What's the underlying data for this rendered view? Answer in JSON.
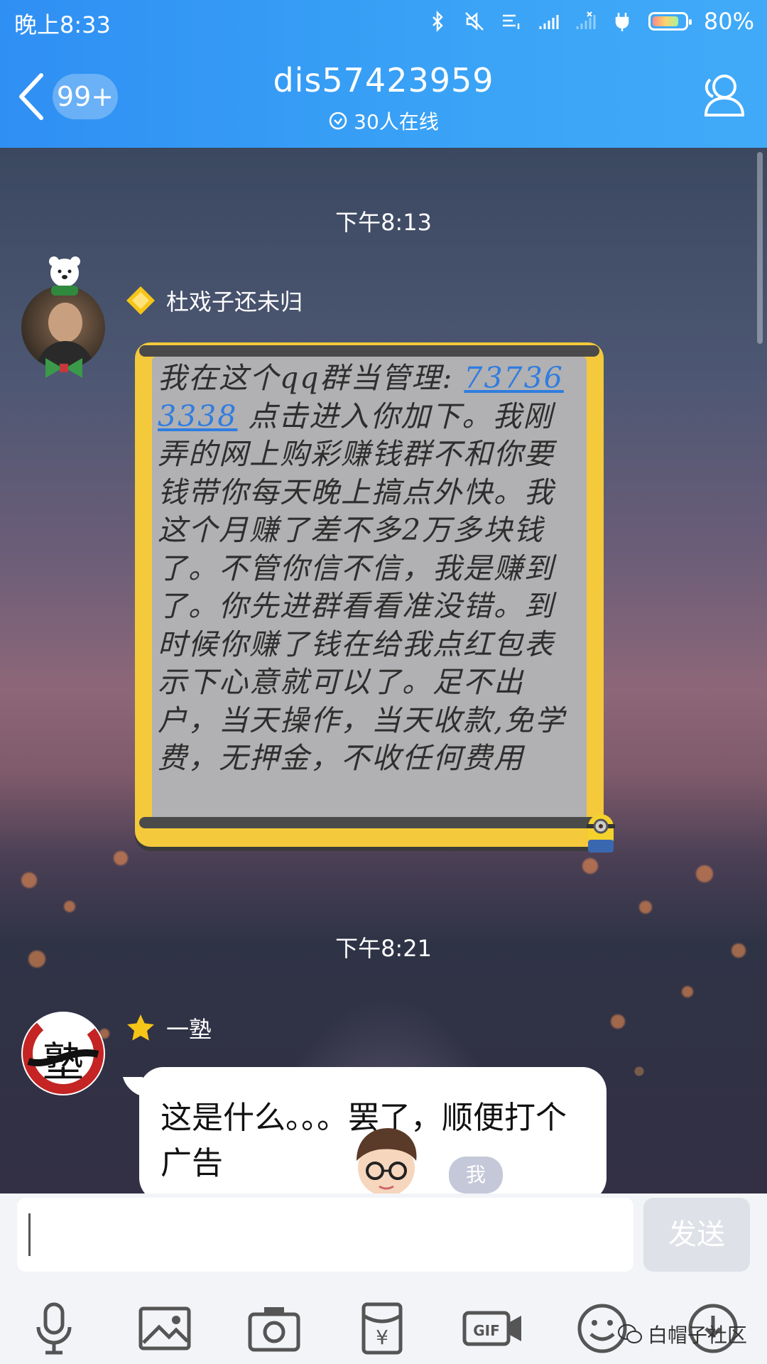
{
  "status_bar": {
    "time": "晚上8:33",
    "battery": "80%"
  },
  "header": {
    "unread_badge": "99+",
    "title": "dis57423959",
    "online": "30人在线"
  },
  "messages": [
    {
      "timestamp": "下午8:13"
    },
    {
      "sender": "杜戏子还未归",
      "sticker_link": "737363338",
      "sticker_text_before": "我在这个qq群当管理:",
      "sticker_text_after": "点击进入你加下。我刚弄的网上购彩赚钱群不和你要钱带你每天晚上搞点外快。我这个月赚了差不多2万多块钱了。不管你信不信，我是赚到了。你先进群看看准没错。到时候你赚了钱在给我点红包表示下心意就可以了。足不出户，当天操作，当天收款,免学费，无押金，不收任何费用"
    },
    {
      "timestamp": "下午8:21"
    },
    {
      "sender": "一塾",
      "avatar_text": "塾",
      "text": "这是什么。。。罢了，顺便打个广告",
      "me_tag": "我"
    }
  ],
  "input": {
    "placeholder": "",
    "send_label": "发送"
  },
  "toolbar": [
    "microphone-icon",
    "image-icon",
    "camera-icon",
    "red-packet-icon",
    "gif-icon",
    "emoji-icon",
    "more-icon"
  ],
  "watermark": "白帽子社区",
  "colors": {
    "header": "#3aa3f6",
    "bubble": "#ffffff",
    "sticker_frame": "#f4c93b",
    "link": "#2f7de0"
  }
}
